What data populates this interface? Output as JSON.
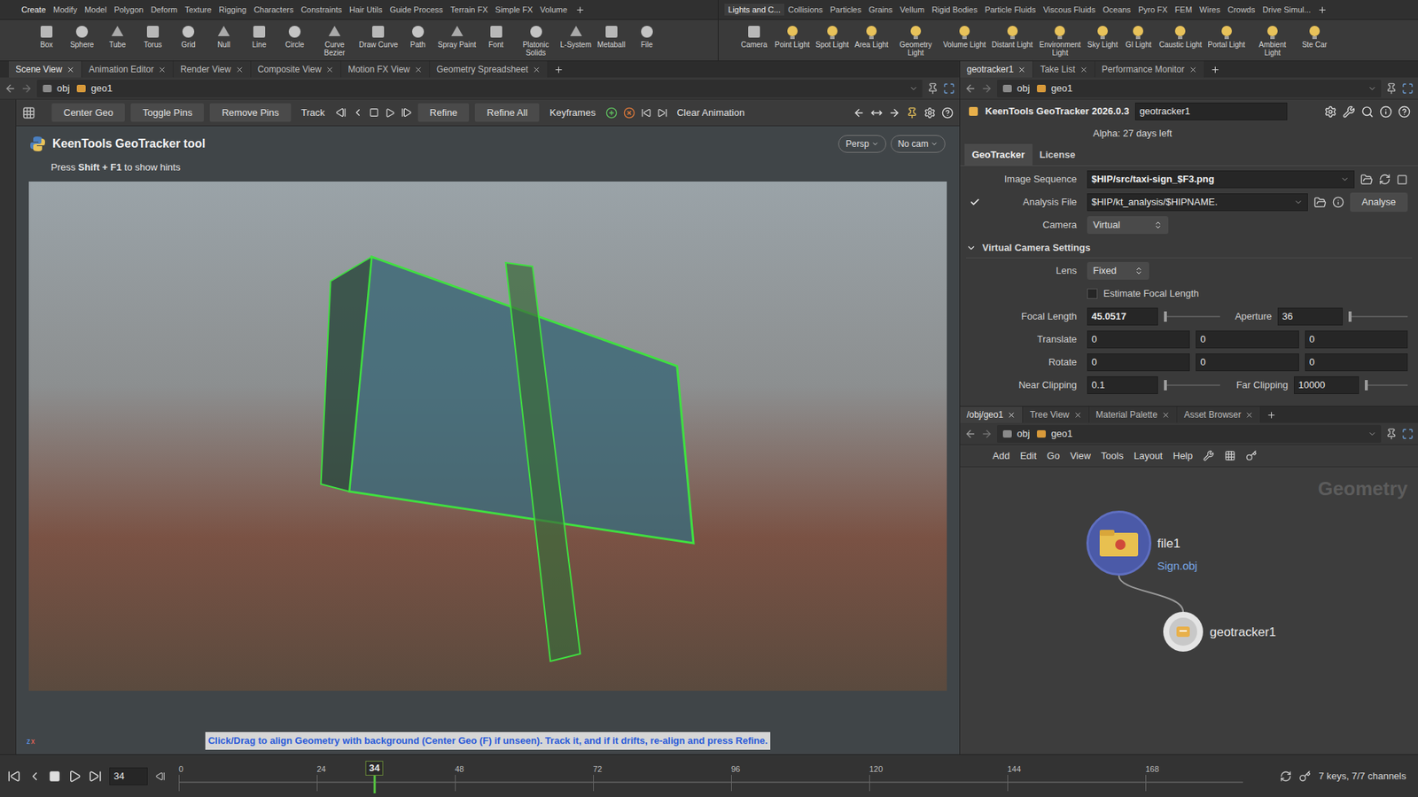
{
  "shelf": {
    "tabs_left": [
      "Create",
      "Modify",
      "Model",
      "Polygon",
      "Deform",
      "Texture",
      "Rigging",
      "Characters",
      "Constraints",
      "Hair Utils",
      "Guide Process",
      "Terrain FX",
      "Simple FX",
      "Volume"
    ],
    "tabs_right": [
      "Lights and C...",
      "Collisions",
      "Particles",
      "Grains",
      "Vellum",
      "Rigid Bodies",
      "Particle Fluids",
      "Viscous Fluids",
      "Oceans",
      "Pyro FX",
      "FEM",
      "Wires",
      "Crowds",
      "Drive Simul..."
    ],
    "tools_left": [
      "Box",
      "Sphere",
      "Tube",
      "Torus",
      "Grid",
      "Null",
      "Line",
      "Circle",
      "Curve Bezier",
      "Draw Curve",
      "Path",
      "Spray Paint",
      "Font",
      "Platonic Solids",
      "L-System",
      "Metaball",
      "File"
    ],
    "tools_right": [
      "Camera",
      "Point Light",
      "Spot Light",
      "Area Light",
      "Geometry Light",
      "Volume Light",
      "Distant Light",
      "Environment Light",
      "Sky Light",
      "GI Light",
      "Caustic Light",
      "Portal Light",
      "Ambient Light",
      "Ste Car"
    ]
  },
  "left_pane": {
    "tabs": [
      {
        "label": "Scene View",
        "selected": true
      },
      {
        "label": "Animation Editor",
        "selected": false
      },
      {
        "label": "Render View",
        "selected": false
      },
      {
        "label": "Composite View",
        "selected": false
      },
      {
        "label": "Motion FX View",
        "selected": false
      },
      {
        "label": "Geometry Spreadsheet",
        "selected": false
      }
    ],
    "path": [
      "obj",
      "geo1"
    ]
  },
  "viewport_toolbar": {
    "buttons": [
      "Center Geo",
      "Toggle Pins",
      "Remove Pins"
    ],
    "track": "Track",
    "refine": [
      "Refine",
      "Refine All"
    ],
    "keyframes": "Keyframes",
    "clear": "Clear Animation"
  },
  "viewport": {
    "tool_title": "KeenTools GeoTracker tool",
    "hint_prefix": "Press ",
    "hint_key": "Shift + F1",
    "hint_suffix": " to show hints",
    "view_menu": "Persp",
    "cam_menu": "No cam",
    "status_hint": "Click/Drag to align Geometry with background (Center Geo (F) if unseen). Track it, and if it drifts, re-align and press Refine.",
    "axes": [
      "z",
      "x"
    ]
  },
  "timeline": {
    "frame_field": "34",
    "marker_label": "34",
    "current_frame": 34,
    "ticks": [
      "0",
      "24",
      "48",
      "72",
      "96",
      "120",
      "144",
      "168"
    ],
    "keys_info": "7 keys, 7/7 channels"
  },
  "param_pane": {
    "tabs": [
      {
        "label": "geotracker1",
        "selected": true
      },
      {
        "label": "Take List",
        "selected": false
      },
      {
        "label": "Performance Monitor",
        "selected": false
      }
    ],
    "path": [
      "obj",
      "geo1"
    ],
    "node_type": "KeenTools GeoTracker 2026.0.3",
    "node_name": "geotracker1",
    "alpha": "Alpha: 27 days left",
    "param_tabs": [
      {
        "label": "GeoTracker",
        "selected": true
      },
      {
        "label": "License",
        "selected": false
      }
    ],
    "image_sequence": {
      "label": "Image Sequence",
      "value": "$HIP/src/taxi-sign_$F3.png"
    },
    "analysis_file": {
      "label": "Analysis File",
      "value": "$HIP/kt_analysis/$HIPNAME.",
      "checked": true,
      "button": "Analyse"
    },
    "camera": {
      "label": "Camera",
      "value": "Virtual"
    },
    "section": {
      "label": "Virtual Camera Settings",
      "expanded": true
    },
    "lens": {
      "label": "Lens",
      "value": "Fixed"
    },
    "estimate": {
      "label": "Estimate Focal Length",
      "checked": false
    },
    "focal_length": {
      "label": "Focal Length",
      "value": "45.0517",
      "level": 0
    },
    "aperture": {
      "label": "Aperture",
      "value": "36",
      "level": 0
    },
    "translate": {
      "label": "Translate",
      "values": [
        "0",
        "0",
        "0"
      ]
    },
    "rotate": {
      "label": "Rotate",
      "values": [
        "0",
        "0",
        "0"
      ]
    },
    "near_clipping": {
      "label": "Near Clipping",
      "value": "0.1",
      "level": 0
    },
    "far_clipping": {
      "label": "Far Clipping",
      "value": "10000",
      "level": 0
    }
  },
  "network_pane": {
    "tabs": [
      {
        "label": "/obj/geo1",
        "selected": true
      },
      {
        "label": "Tree View",
        "selected": false
      },
      {
        "label": "Material Palette",
        "selected": false
      },
      {
        "label": "Asset Browser",
        "selected": false
      }
    ],
    "path": [
      "obj",
      "geo1"
    ],
    "menu": [
      "Add",
      "Edit",
      "Go",
      "View",
      "Tools",
      "Layout",
      "Help"
    ],
    "watermark": "Geometry",
    "nodes": [
      {
        "name": "file1",
        "subtitle": "Sign.obj"
      },
      {
        "name": "geotracker1",
        "subtitle": ""
      }
    ]
  }
}
